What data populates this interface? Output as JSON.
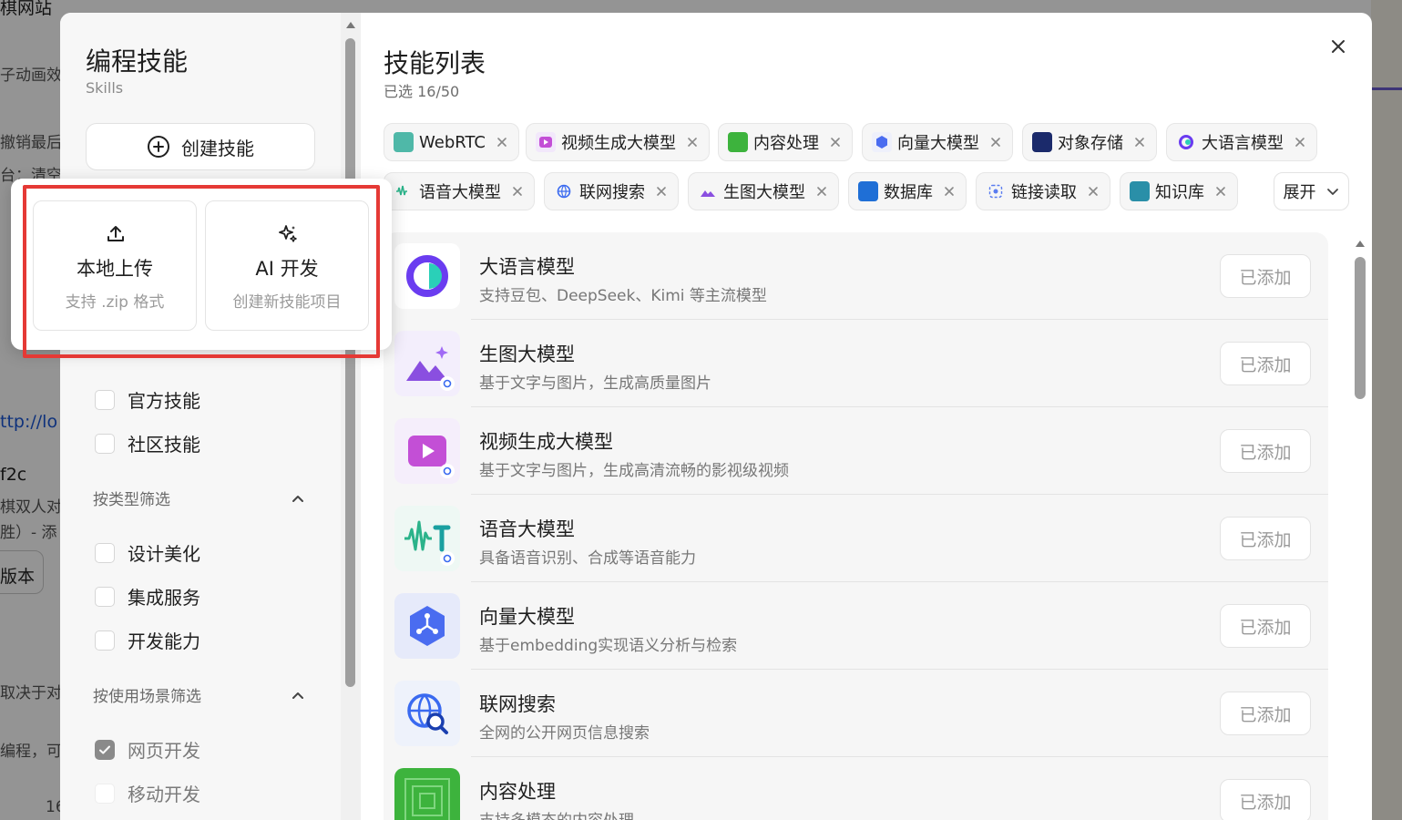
{
  "background": {
    "snippets": [
      "棋网站",
      "子动画效",
      "撤销最后",
      "台：清空",
      "ttp://lo",
      "f2c",
      "棋双人对战",
      "胜）- 添",
      "版本",
      "取决于对",
      "编程，可",
      "16"
    ]
  },
  "modal": {
    "left": {
      "title": "编程技能",
      "subtitle": "Skills",
      "create_label": "创建技能",
      "source_filters": [
        {
          "label": "官方技能",
          "checked": false
        },
        {
          "label": "社区技能",
          "checked": false
        }
      ],
      "type_section": "按类型筛选",
      "type_filters": [
        {
          "label": "设计美化",
          "checked": false
        },
        {
          "label": "集成服务",
          "checked": false
        },
        {
          "label": "开发能力",
          "checked": false
        }
      ],
      "scene_section": "按使用场景筛选",
      "scene_filters": [
        {
          "label": "网页开发",
          "checked": true
        },
        {
          "label": "移动开发",
          "checked": false
        }
      ]
    },
    "right": {
      "title": "技能列表",
      "selected": "已选 16/50",
      "expand_label": "展开",
      "tags": [
        {
          "label": "WebRTC"
        },
        {
          "label": "视频生成大模型"
        },
        {
          "label": "内容处理"
        },
        {
          "label": "向量大模型"
        },
        {
          "label": "对象存储"
        },
        {
          "label": "大语言模型"
        },
        {
          "label": "语音大模型"
        },
        {
          "label": "联网搜索"
        },
        {
          "label": "生图大模型"
        },
        {
          "label": "数据库"
        },
        {
          "label": "链接读取"
        },
        {
          "label": "知识库"
        }
      ],
      "skills": [
        {
          "name": "大语言模型",
          "desc": "支持豆包、DeepSeek、Kimi 等主流模型",
          "btn": "已添加"
        },
        {
          "name": "生图大模型",
          "desc": "基于文字与图片，生成高质量图片",
          "btn": "已添加"
        },
        {
          "name": "视频生成大模型",
          "desc": "基于文字与图片，生成高清流畅的影视级视频",
          "btn": "已添加"
        },
        {
          "name": "语音大模型",
          "desc": "具备语音识别、合成等语音能力",
          "btn": "已添加"
        },
        {
          "name": "向量大模型",
          "desc": "基于embedding实现语义分析与检索",
          "btn": "已添加"
        },
        {
          "name": "联网搜索",
          "desc": "全网的公开网页信息搜索",
          "btn": "已添加"
        },
        {
          "name": "内容处理",
          "desc": "支持多模态的内容处理",
          "btn": "已添加"
        }
      ]
    },
    "popover": {
      "upload": {
        "title": "本地上传",
        "desc": "支持 .zip 格式"
      },
      "ai": {
        "title": "AI 开发",
        "desc": "创建新技能项目"
      }
    }
  },
  "colors": {
    "highlight": "#e53935",
    "checked": "#8a8a8a"
  }
}
